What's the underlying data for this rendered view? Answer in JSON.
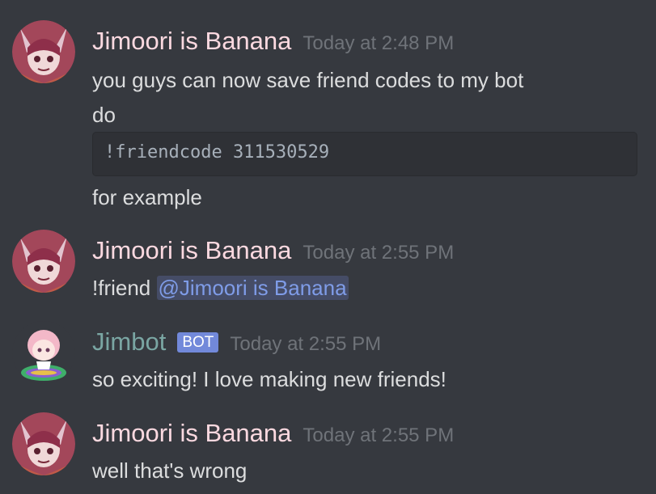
{
  "messages": [
    {
      "username": "Jimoori is Banana",
      "timestamp": "Today at 2:48 PM",
      "lines": [
        "you guys can now save friend codes to my bot",
        "do"
      ],
      "code": "!friendcode 311530529",
      "after_code": "for example"
    },
    {
      "username": "Jimoori is Banana",
      "timestamp": "Today at 2:55 PM",
      "text_prefix": "!friend ",
      "mention": "@Jimoori is Banana"
    },
    {
      "username": "Jimbot",
      "bot_tag": "BOT",
      "timestamp": "Today at 2:55 PM",
      "text": "so exciting! I love making new friends!"
    },
    {
      "username": "Jimoori is Banana",
      "timestamp": "Today at 2:55 PM",
      "text": "well that's wrong"
    }
  ],
  "colors": {
    "background": "#36393f",
    "username": "#fbd9e0",
    "bot_username": "#7aa6a3",
    "timestamp": "#6f7379",
    "bot_tag": "#7289da",
    "mention": "#7f9ce8"
  },
  "icons": {
    "user_avatar": "anime-avatar-icon",
    "bot_avatar": "bot-avatar-icon"
  }
}
